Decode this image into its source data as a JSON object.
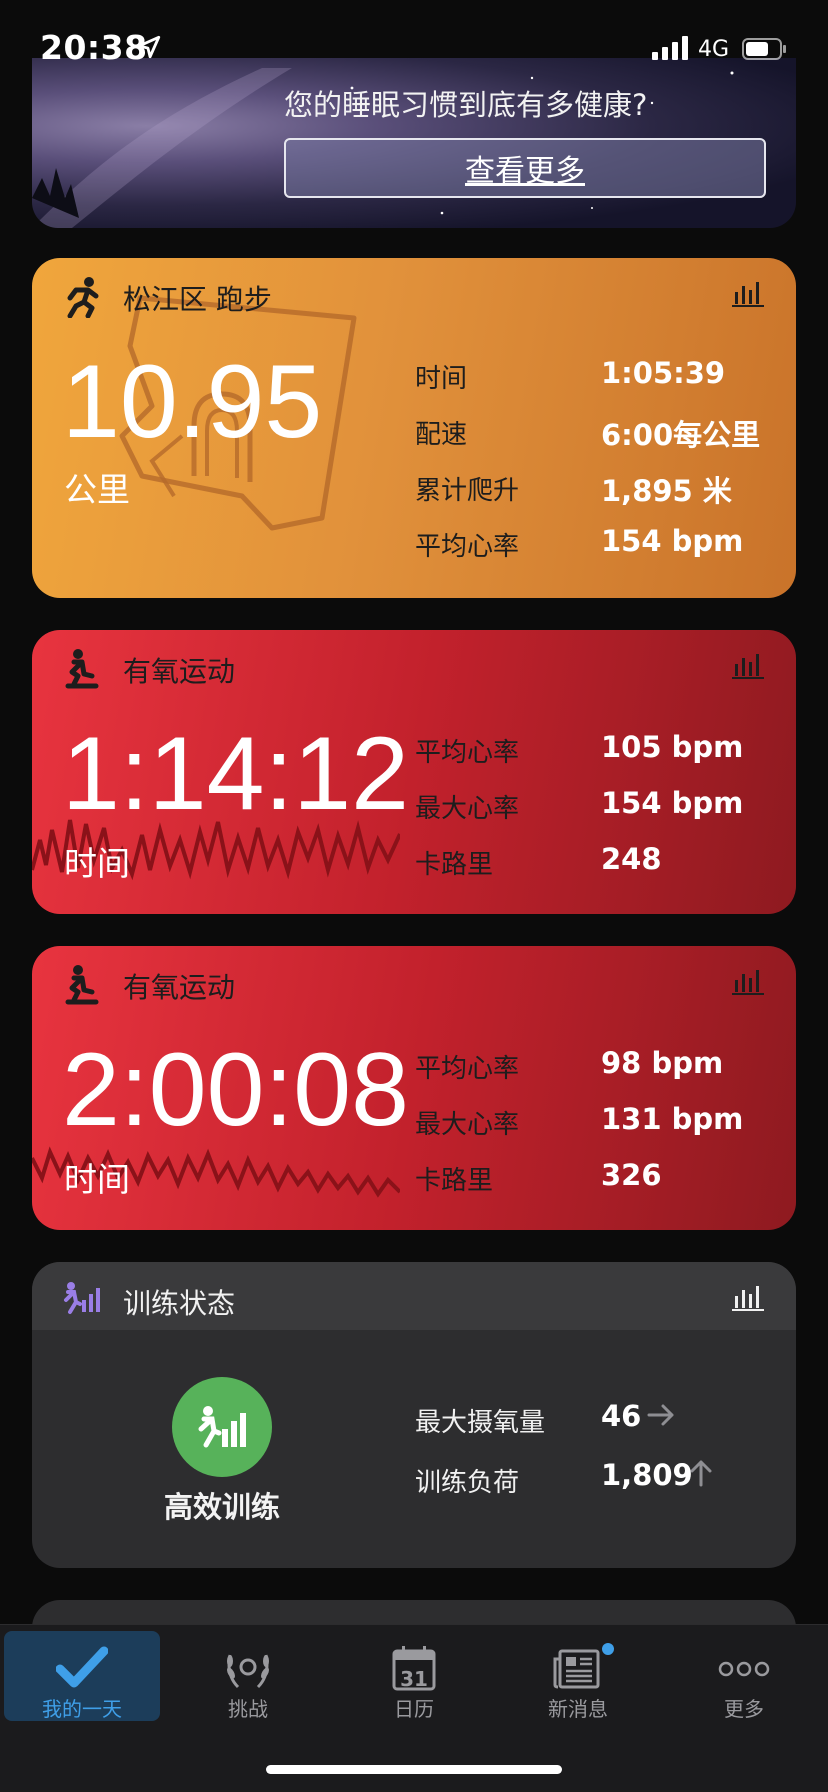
{
  "status": {
    "time": "20:38",
    "network": "4G"
  },
  "banner": {
    "title": "您的睡眠习惯到底有多健康?",
    "button": "查看更多"
  },
  "run_card": {
    "title": "松江区 跑步",
    "big_value": "10.95",
    "big_unit": "公里",
    "metrics": [
      {
        "label": "时间",
        "value": "1:05:39"
      },
      {
        "label": "配速",
        "value": "6:00每公里"
      },
      {
        "label": "累计爬升",
        "value": "1,895 米"
      },
      {
        "label": "平均心率",
        "value": "154 bpm"
      }
    ]
  },
  "cardio_card_1": {
    "title": "有氧运动",
    "big_value": "1:14:12",
    "big_unit": "时间",
    "metrics": [
      {
        "label": "平均心率",
        "value": "105 bpm"
      },
      {
        "label": "最大心率",
        "value": "154 bpm"
      },
      {
        "label": "卡路里",
        "value": "248"
      }
    ]
  },
  "cardio_card_2": {
    "title": "有氧运动",
    "big_value": "2:00:08",
    "big_unit": "时间",
    "metrics": [
      {
        "label": "平均心率",
        "value": "98 bpm"
      },
      {
        "label": "最大心率",
        "value": "131 bpm"
      },
      {
        "label": "卡路里",
        "value": "326"
      }
    ]
  },
  "training_card": {
    "title": "训练状态",
    "status_name": "高效训练",
    "metrics": [
      {
        "label": "最大摄氧量",
        "value": "46",
        "trend": "arrow-right-icon"
      },
      {
        "label": "训练负荷",
        "value": "1,809",
        "trend": "arrow-up-icon"
      }
    ]
  },
  "tabs": [
    {
      "label": "我的一天",
      "icon": "checkmark-icon",
      "active": true
    },
    {
      "label": "挑战",
      "icon": "laurel-icon",
      "active": false
    },
    {
      "label": "日历",
      "icon": "calendar-icon",
      "active": false,
      "day": "31"
    },
    {
      "label": "新消息",
      "icon": "newspaper-icon",
      "active": false
    },
    {
      "label": "更多",
      "icon": "more-icon",
      "active": false
    }
  ],
  "colors": {
    "run_card": "#e49a3b",
    "cardio_card": "#d42a34",
    "training_status": "#57b25a",
    "tab_active": "#3f9fe8"
  }
}
